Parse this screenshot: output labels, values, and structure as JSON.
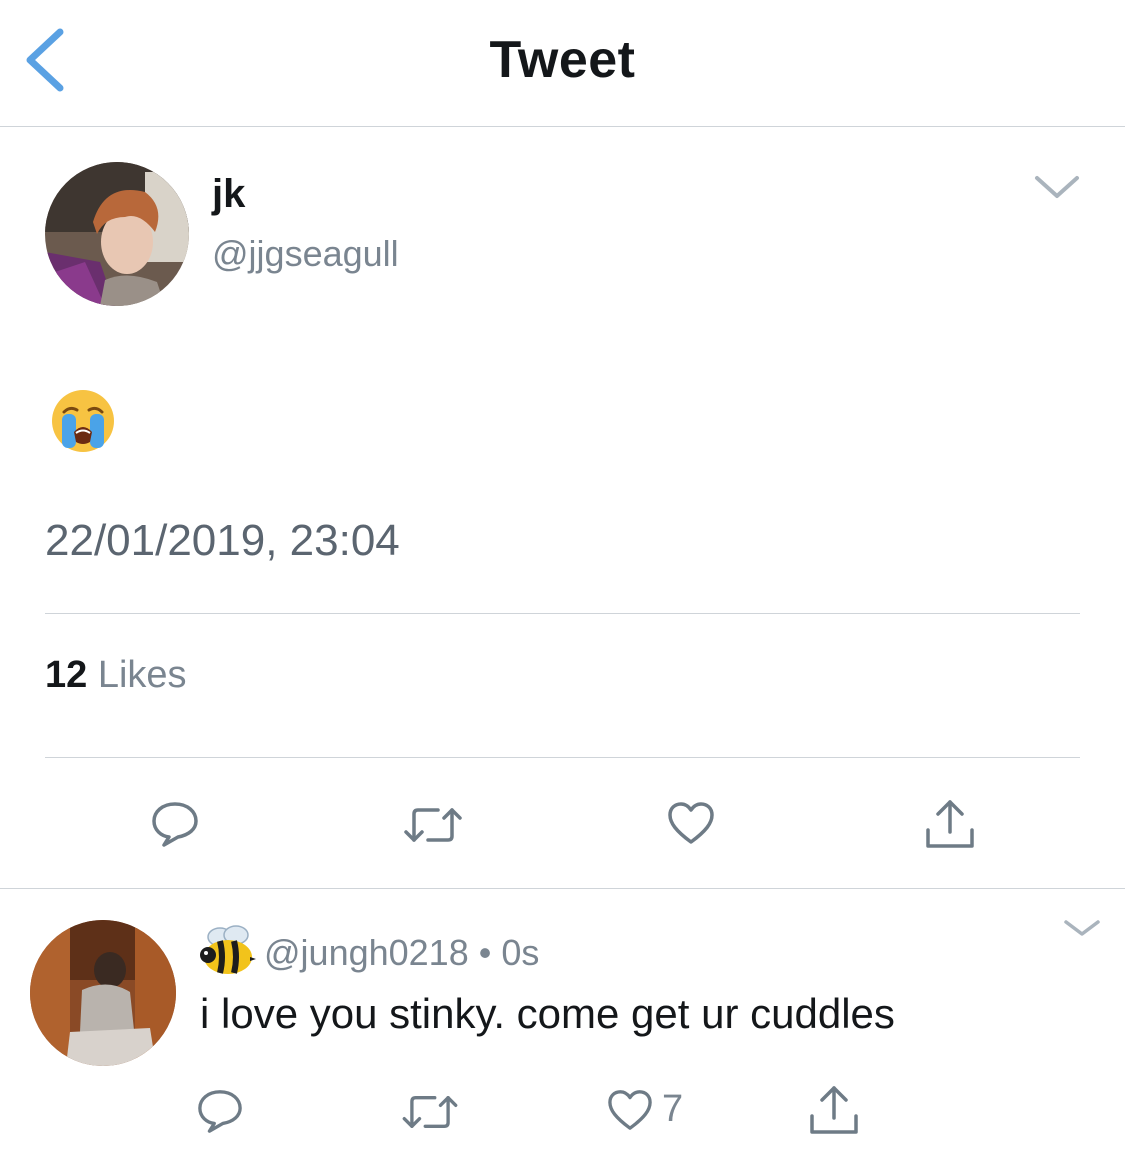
{
  "header": {
    "title": "Tweet",
    "back_icon": "chevron-left-icon",
    "accent_color": "#5aa1e3"
  },
  "tweet": {
    "display_name": "jk",
    "handle": "@jjgseagull",
    "content_emoji": "loudly-crying-face",
    "timestamp": "22/01/2019, 23:04",
    "likes_count": "12",
    "likes_label": "Likes",
    "actions": [
      "reply-icon",
      "retweet-icon",
      "like-icon",
      "share-icon"
    ]
  },
  "reply": {
    "name_emoji": "bee",
    "handle": "@jungh0218",
    "separator": "•",
    "time": "0s",
    "text": "i love you stinky. come get ur cuddles",
    "like_count": "7",
    "actions": [
      "reply-icon",
      "retweet-icon",
      "like-icon",
      "share-icon"
    ]
  },
  "colors": {
    "text": "#14171a",
    "muted": "#7a8590",
    "divider": "#cfd4d9",
    "icon": "#6e7b86"
  }
}
